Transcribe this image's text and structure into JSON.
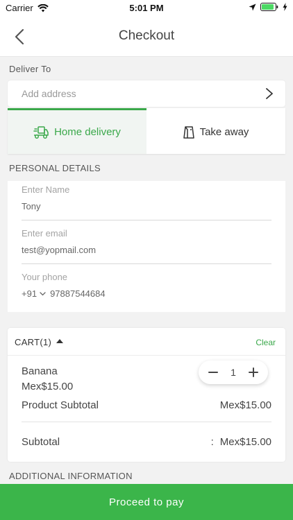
{
  "status_bar": {
    "carrier": "Carrier",
    "time": "5:01 PM"
  },
  "nav": {
    "title": "Checkout"
  },
  "deliver": {
    "label": "Deliver To",
    "address_placeholder": "Add address"
  },
  "delivery_tabs": {
    "home": "Home delivery",
    "takeaway": "Take away",
    "active": "home"
  },
  "personal": {
    "label": "PERSONAL DETAILS",
    "name_label": "Enter Name",
    "name_value": "Tony",
    "email_label": "Enter email",
    "email_value": "test@yopmail.com",
    "phone_label": "Your phone",
    "phone_code": "+91",
    "phone_value": "97887544684"
  },
  "cart": {
    "title": "CART(1)",
    "clear": "Clear",
    "item": {
      "name": "Banana",
      "price": "Mex$15.00",
      "qty": "1"
    },
    "product_subtotal_label": "Product Subtotal",
    "product_subtotal_value": "Mex$15.00",
    "subtotal_label": "Subtotal",
    "subtotal_sep": ":",
    "subtotal_value": "Mex$15.00"
  },
  "additional": {
    "label": "ADDITIONAL INFORMATION"
  },
  "proceed": {
    "label": "Proceed to pay"
  },
  "colors": {
    "accent": "#3bb54a",
    "background": "#f2f2f2"
  },
  "icons": [
    "wifi-icon",
    "location-arrow-icon",
    "battery-icon",
    "charging-icon",
    "back-chevron-icon",
    "chevron-right-icon",
    "delivery-truck-icon",
    "takeaway-bag-icon",
    "caret-up-icon",
    "minus-icon",
    "plus-icon",
    "chevron-down-icon"
  ]
}
